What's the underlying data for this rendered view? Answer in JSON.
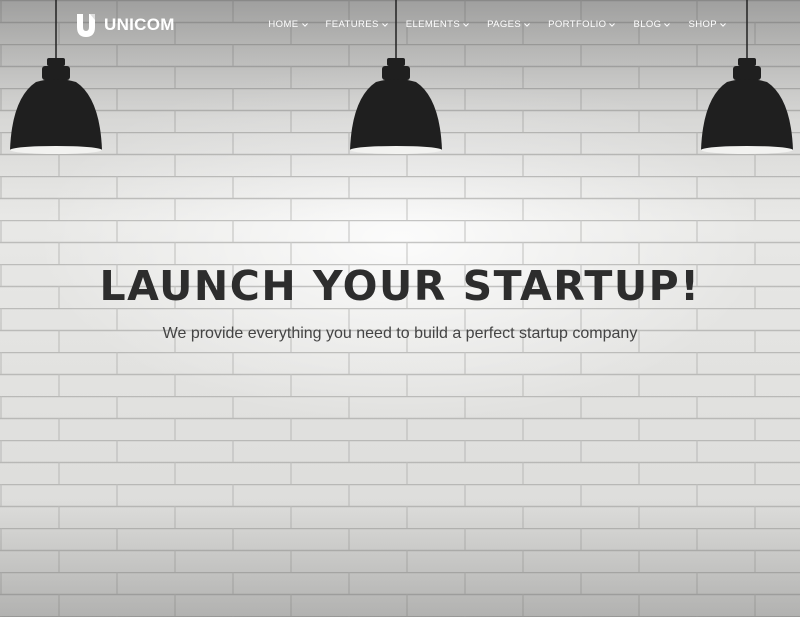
{
  "brand": {
    "name": "UNICOM",
    "logo_icon": "u-logo-icon"
  },
  "nav": {
    "items": [
      {
        "label": "HOME"
      },
      {
        "label": "FEATURES"
      },
      {
        "label": "ELEMENTS"
      },
      {
        "label": "PAGES"
      },
      {
        "label": "PORTFOLIO"
      },
      {
        "label": "BLOG"
      },
      {
        "label": "SHOP"
      }
    ]
  },
  "hero": {
    "headline": "LAUNCH YOUR STARTUP!",
    "tagline": "We provide everything you need to build a perfect startup company"
  },
  "colors": {
    "headline": "#2d2d2d",
    "nav_text": "#ffffff",
    "lamp": "#1f1f1f"
  }
}
